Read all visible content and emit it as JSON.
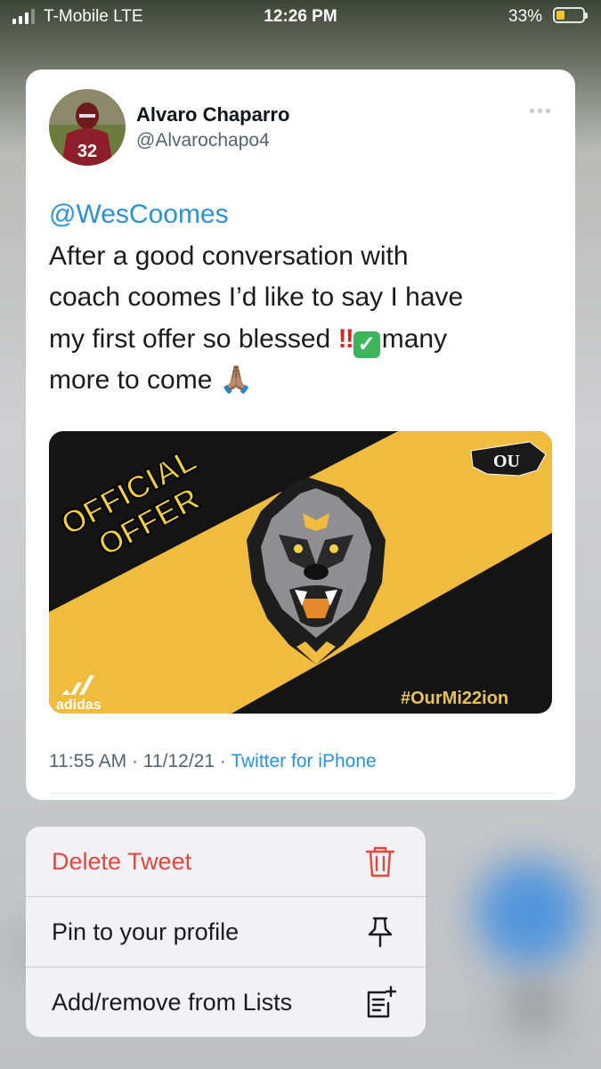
{
  "status_bar": {
    "carrier": "T-Mobile  LTE",
    "time": "12:26 PM",
    "battery_percent": "33%",
    "battery_level": 0.33
  },
  "tweet": {
    "author_name": "Alvaro Chaparro",
    "author_handle": "@Alvarochapo4",
    "mention": "@WesCoomes",
    "body_line_1": "After a good conversation with",
    "body_line_2": "coach coomes I’d like to say I have",
    "body_line_3_start": "my first offer so blessed ",
    "body_bang": "‼",
    "body_line_3_end": "many",
    "body_line_4": "more to come ",
    "body_pray": "🙏🏽",
    "timestamp": "11:55 AM · 11/12/21 · ",
    "source": "Twitter for iPhone",
    "avatar_jersey": "32",
    "media": {
      "headline_1": "OFFICIAL",
      "headline_2": "OFFER",
      "logo_text": "OU",
      "brand": "adidas",
      "hashtag": "#OurMi22ion",
      "colors": {
        "black": "#141414",
        "gold": "#efbc3f"
      }
    }
  },
  "menu": {
    "items": [
      {
        "label": "Delete Tweet",
        "icon": "trash-icon",
        "color": "#e0473e"
      },
      {
        "label": "Pin to your profile",
        "icon": "pin-icon"
      },
      {
        "label": "Add/remove from Lists",
        "icon": "list-add-icon"
      }
    ]
  }
}
